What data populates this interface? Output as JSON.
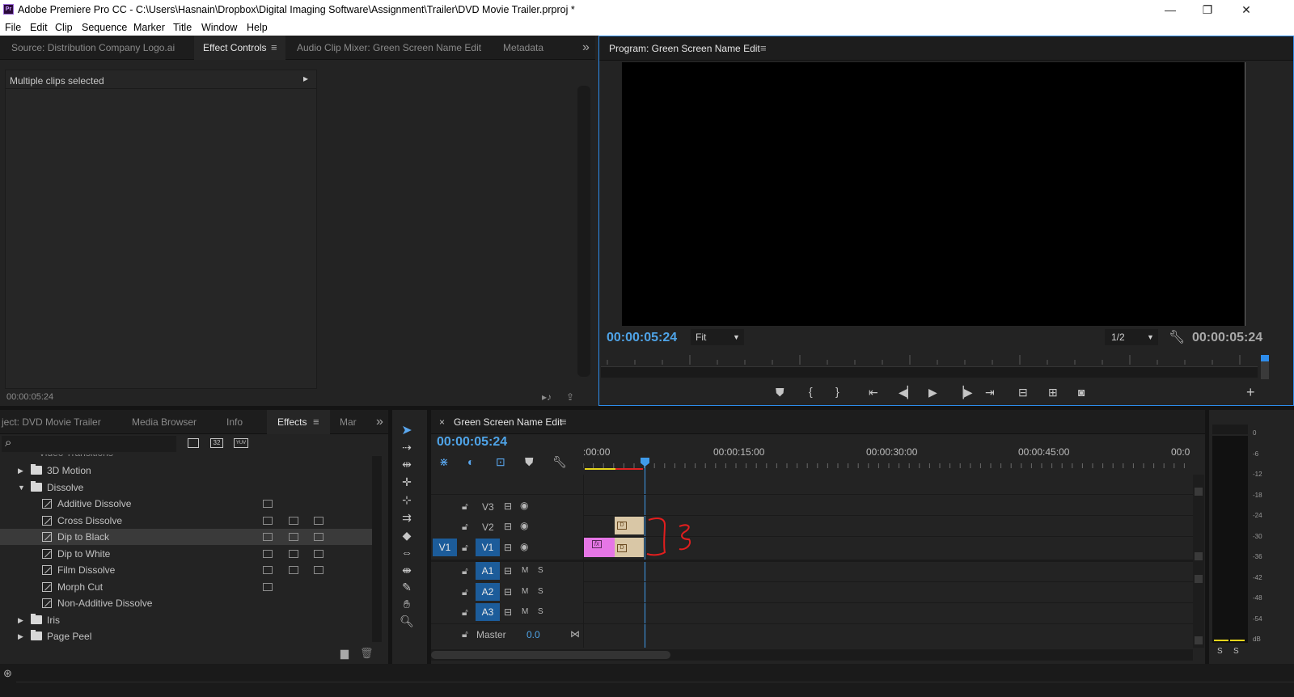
{
  "window": {
    "title": "Adobe Premiere Pro CC - C:\\Users\\Hasnain\\Dropbox\\Digital Imaging Software\\Assignment\\Trailer\\DVD Movie Trailer.prproj *",
    "app_icon": "Pr",
    "minimize": "—",
    "restore": "❐",
    "close": "✕"
  },
  "menu": [
    "File",
    "Edit",
    "Clip",
    "Sequence",
    "Marker",
    "Title",
    "Window",
    "Help"
  ],
  "source_panel": {
    "tabs": [
      "Source: Distribution Company Logo.ai",
      "Effect Controls",
      "Audio Clip Mixer: Green Screen Name Edit",
      "Metadata"
    ],
    "active_tab": "Effect Controls",
    "more": "»",
    "message": "Multiple clips selected",
    "expand_arrow": "▸",
    "timecode": "00:00:05:24"
  },
  "program_monitor": {
    "title": "Program: Green Screen Name Edit",
    "timecode_left": "00:00:05:24",
    "fit_label": "Fit",
    "resolution": "1/2",
    "timecode_right": "00:00:05:24",
    "add": "+"
  },
  "project_panel": {
    "tabs": [
      "ject: DVD Movie Trailer",
      "Media Browser",
      "Info",
      "Effects",
      "Mar"
    ],
    "active_tab": "Effects",
    "more": "»",
    "search_icon": "⌕",
    "filter_labels": [
      "32",
      "YUV"
    ],
    "cut_row": "Video Transitions",
    "items": [
      {
        "label": "3D Motion",
        "type": "folder",
        "level": 1,
        "expanded": false
      },
      {
        "label": "Dissolve",
        "type": "folder",
        "level": 1,
        "expanded": true
      },
      {
        "label": "Additive Dissolve",
        "type": "effect",
        "level": 2,
        "badges": 1
      },
      {
        "label": "Cross Dissolve",
        "type": "effect",
        "level": 2,
        "badges": 3
      },
      {
        "label": "Dip to Black",
        "type": "effect",
        "level": 2,
        "badges": 3,
        "selected": true
      },
      {
        "label": "Dip to White",
        "type": "effect",
        "level": 2,
        "badges": 3
      },
      {
        "label": "Film Dissolve",
        "type": "effect",
        "level": 2,
        "badges": 3
      },
      {
        "label": "Morph Cut",
        "type": "effect",
        "level": 2,
        "badges": 1
      },
      {
        "label": "Non-Additive Dissolve",
        "type": "effect",
        "level": 2,
        "badges": 0
      },
      {
        "label": "Iris",
        "type": "folder",
        "level": 1,
        "expanded": false
      },
      {
        "label": "Page Peel",
        "type": "folder",
        "level": 1,
        "expanded": false
      }
    ]
  },
  "timeline": {
    "close": "×",
    "title": "Green Screen Name Edit",
    "timecode": "00:00:05:24",
    "ruler_labels": [
      ":00:00",
      "00:00:15:00",
      "00:00:30:00",
      "00:00:45:00",
      "00:0"
    ],
    "video_tracks": [
      "V3",
      "V2",
      "V1"
    ],
    "audio_tracks": [
      "A1",
      "A2",
      "A3"
    ],
    "source_patch": "V1",
    "mute": "M",
    "solo": "S",
    "master_label": "Master",
    "master_value": "0.0",
    "clip_fx": "fx",
    "clip_badge": "D"
  },
  "audio_meter": {
    "scale": [
      "0",
      "-6",
      "-12",
      "-18",
      "-24",
      "-30",
      "-36",
      "-42",
      "-48",
      "-54",
      "dB"
    ],
    "solo_buttons": [
      "S",
      "S"
    ]
  },
  "colors": {
    "accent": "#2d8ceb",
    "timecode": "#4fa4e8",
    "track_button": "#1c5c9a",
    "clip_pink": "#e676e6",
    "clip_tan": "#d9c7a6",
    "annotation": "#e21e1e"
  }
}
